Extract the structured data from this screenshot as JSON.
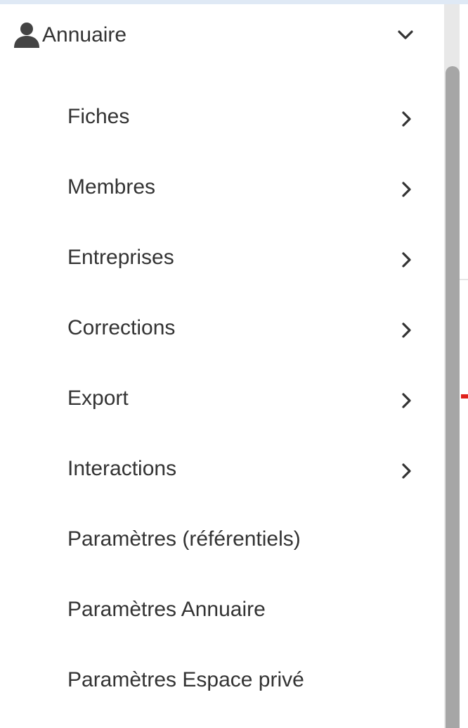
{
  "colors": {
    "text": "#333333",
    "icon": "#444444",
    "top_strip": "#dfe9f5",
    "scrollbar_track": "#e8e8e8",
    "scrollbar_thumb": "#a6a6a6",
    "marker": "#e0201b"
  },
  "menu": {
    "group": {
      "label": "Annuaire",
      "icon": "user-icon",
      "toggle_icon": "chevron-down-icon",
      "expanded": true
    },
    "items": [
      {
        "label": "Fiches",
        "has_submenu": true
      },
      {
        "label": "Membres",
        "has_submenu": true
      },
      {
        "label": "Entreprises",
        "has_submenu": true
      },
      {
        "label": "Corrections",
        "has_submenu": true
      },
      {
        "label": "Export",
        "has_submenu": true
      },
      {
        "label": "Interactions",
        "has_submenu": true
      },
      {
        "label": "Paramètres (référentiels)",
        "has_submenu": false
      },
      {
        "label": "Paramètres Annuaire",
        "has_submenu": false
      },
      {
        "label": "Paramètres Espace privé",
        "has_submenu": false
      }
    ]
  }
}
